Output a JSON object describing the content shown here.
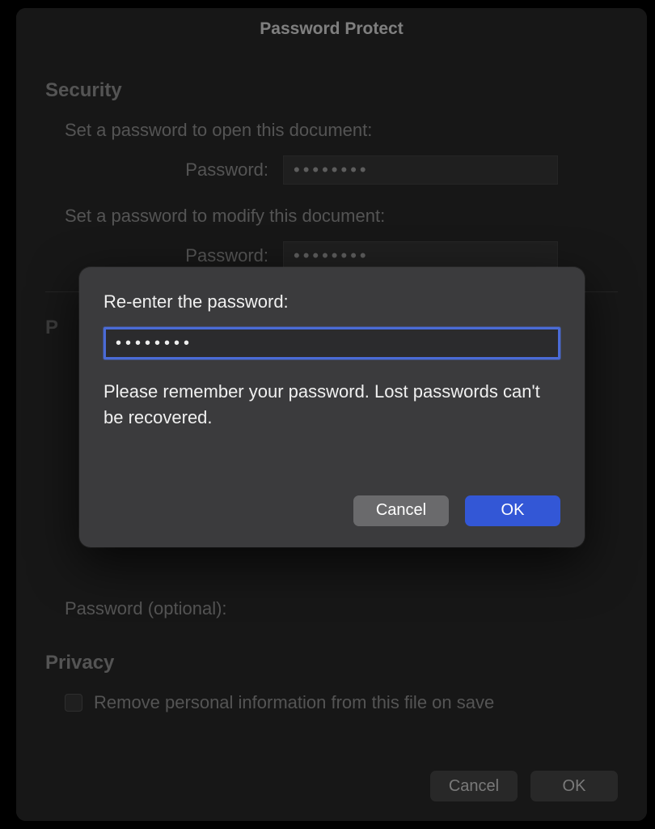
{
  "dialog": {
    "title": "Password Protect",
    "security": {
      "heading": "Security",
      "open_label": "Set a password to open this document:",
      "modify_label": "Set a password to modify this document:",
      "password_label": "Password:",
      "open_value": "••••••••",
      "modify_value": "••••••••",
      "password_optional_label": "Password (optional):"
    },
    "privacy": {
      "heading": "Privacy",
      "remove_info_label": "Remove personal information from this file on save"
    },
    "buttons": {
      "cancel": "Cancel",
      "ok": "OK"
    },
    "partial_section": "P"
  },
  "modal": {
    "title": "Re-enter the password:",
    "value": "••••••••",
    "help": "Please remember your password. Lost passwords can't be recovered.",
    "cancel": "Cancel",
    "ok": "OK"
  }
}
